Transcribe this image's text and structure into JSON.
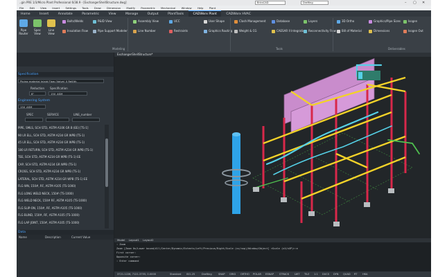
{
  "title_bar": {
    "app_title": "..gin PRE 1/3/Micro Plant Professional 6/38.9 - [ExchangerShellStructure.dwg]",
    "workspace_combo": "Drafting",
    "layer_combo": "BricsCAD"
  },
  "menu": [
    "File",
    "Edit",
    "View",
    "Insert",
    "Settings",
    "Tools",
    "Draw",
    "Dimension",
    "Modify",
    "Parametric",
    "Mechanical",
    "Window",
    "Help",
    "Plant"
  ],
  "ribbon_tabs": [
    {
      "label": "Home"
    },
    {
      "label": "Insert"
    },
    {
      "label": "Annotate"
    },
    {
      "label": "Parametric"
    },
    {
      "label": "View"
    },
    {
      "label": "Manage"
    },
    {
      "label": "Output"
    },
    {
      "label": "PlantTools"
    },
    {
      "label": "CADWorx Plant",
      "active": true
    },
    {
      "label": "CADWorx HVAC"
    }
  ],
  "ribbon": {
    "buttons": [
      {
        "label": "Pipe Router",
        "name": "pipe-router-button",
        "icon": "#5fa9e6"
      },
      {
        "label": "Spec View",
        "name": "spec-view-button",
        "icon": "#7cc36a"
      },
      {
        "label": "Line View",
        "name": "line-view-button",
        "icon": "#e0c14d"
      },
      {
        "label": "Bolts/Welds",
        "name": "bolts-welds-button",
        "icon": "#c98be0"
      },
      {
        "label": "Insulation Flow",
        "name": "insulation-flow-button",
        "icon": "#e07d5a"
      },
      {
        "label": "P&ID View",
        "name": "pid-view-button",
        "icon": "#6fc0d6"
      },
      {
        "label": "Pipe Support Modeler",
        "name": "pipe-support-modeler-button",
        "icon": "#9bb3c9"
      },
      {
        "label": "Assembly View",
        "name": "assembly-view-button",
        "icon": "#8fd17b"
      },
      {
        "label": "Line Number",
        "name": "line-number-button",
        "icon": "#d9a34d"
      },
      {
        "label": "UCC",
        "name": "ucc-button",
        "icon": "#5fa9e6"
      },
      {
        "label": "Restraints",
        "name": "restraints-button",
        "icon": "#e05f5f"
      },
      {
        "label": "User Shape",
        "name": "user-shape-button",
        "icon": "#d7d7d7"
      },
      {
        "label": "Graphics Routing",
        "name": "graphics-routing-button",
        "icon": "#7fb2e0"
      },
      {
        "label": "Clash Management",
        "name": "clash-management-button",
        "icon": "#e08f3c"
      },
      {
        "label": "Weight & CG",
        "name": "weight-cg-button",
        "icon": "#bfbfbf"
      },
      {
        "label": "Database",
        "name": "database-button",
        "icon": "#5f8fe0"
      },
      {
        "label": "CAESAR II Integration",
        "name": "caesar-integration-button",
        "icon": "#e0c14d"
      },
      {
        "label": "Layers",
        "name": "layers-button",
        "icon": "#7cc36a"
      },
      {
        "label": "Reconnectivity Flow",
        "name": "reconnectivity-flow-button",
        "icon": "#6fc0d6"
      },
      {
        "label": "3D Ortho",
        "name": "3d-ortho-button",
        "icon": "#5fa9e6"
      },
      {
        "label": "Bill of Material",
        "name": "bill-of-material-button",
        "icon": "#d7d7d7"
      },
      {
        "label": "Graphics/Pipe Sizes",
        "name": "graphics-pipe-sizes-button",
        "icon": "#c98be0"
      },
      {
        "label": "Dimensions",
        "name": "dimensions-button",
        "icon": "#e0c14d"
      },
      {
        "label": "Isogen",
        "name": "isogen-button",
        "icon": "#7cc36a"
      },
      {
        "label": "Isogen Out",
        "name": "isogen-out-button",
        "icon": "#e07d5a"
      }
    ],
    "groups": [
      "Modeling",
      "Tools",
      "Deliverables"
    ]
  },
  "side_panel": {
    "header": "Specification",
    "spec_file": "Piping material Inlaid Flow (Valve) 0 Rel0th",
    "reduction_label": "Reduction",
    "specification_label": "Specification",
    "size_value": "6\"",
    "spec_value": "150_ASM",
    "section_header": "Engineering System",
    "system_value": "150_ASM",
    "columns": [
      "SPEC",
      "SERVICE",
      "LINE_number"
    ],
    "pipe_items": [
      "PIPE, SMLS, SCH STD, ASTM A106 GR B (EE) [TS-1]",
      "90 LR ELL, SCH STD, ASTM A234 GR WPB (TS-1)",
      "45 LR ELL, SCH STD, ASTM A234 GR WPB (TS-1)",
      "180 LR RETURN, SCH STD, ASTM A234 GR WPB (TS-1)",
      "TEE, SCH STD, ASTM A234 GR WPB (TS-1) EE",
      "CAP, SCH STD, ASTM A234 GR WPB (TS-1)",
      "CROSS, SCH STD, ASTM A234 GR WPB (TS-1)",
      "LATERAL, SCH STD, ASTM A234 GR WPB (TS-1) EE",
      "FLG WN, 150#, RF, ASTM A105 (TS-1000)",
      "FLG LONG WELD NECK, 150# (TS-1000)",
      "FLG WELD NECK, 150# RF, ASTM A105 (TS-1000)",
      "FLG SLIP-ON, 150#, RF, ASTM A105 (TS-1000)",
      "FLG BLIND, 150#, RF, ASTM A105 (TS-1000)",
      "FLG LAP JOINT, 150#, ASTM A105 (TS-1000)"
    ],
    "props_header": "Data",
    "props_columns": [
      "Name",
      "Description",
      "Current Value"
    ]
  },
  "viewport": {
    "doc_tab": "ExchangerShellStructure*"
  },
  "model_tabs": [
    "Model",
    "Layout1",
    "Layout2"
  ],
  "command_lines": [
    ": Zoom",
    "Zoom [Zoom On/Lower bound/All/Center/Dynamic/Extents/Left/Previous/Right/Scale (nx/nxp)/Window/Object] <Scale (nX/nXP)>:e",
    "First corner:",
    "Opposite corner:",
    ": Enter command"
  ],
  "status_bar": {
    "coords": "3721.1226, 7121.3755, 0.0000",
    "items": [
      "Standard",
      "ISO-25",
      "Drafting",
      "SNAP",
      "GRID",
      "ORTHO",
      "POLAR",
      "ESNAP",
      "STRACK",
      "LWT",
      "TILE",
      "1:1",
      "DUCS",
      "DYN",
      "QUAD",
      "RT",
      "HKA"
    ]
  },
  "colors": {
    "structure_red": "#d8284a",
    "structure_yellow": "#f2d229",
    "pipe_cyan": "#55d0e6",
    "vessel_blue": "#2ea3e8",
    "equipment_pink": "#d69ad9",
    "pipe_green": "#4fc04f"
  }
}
